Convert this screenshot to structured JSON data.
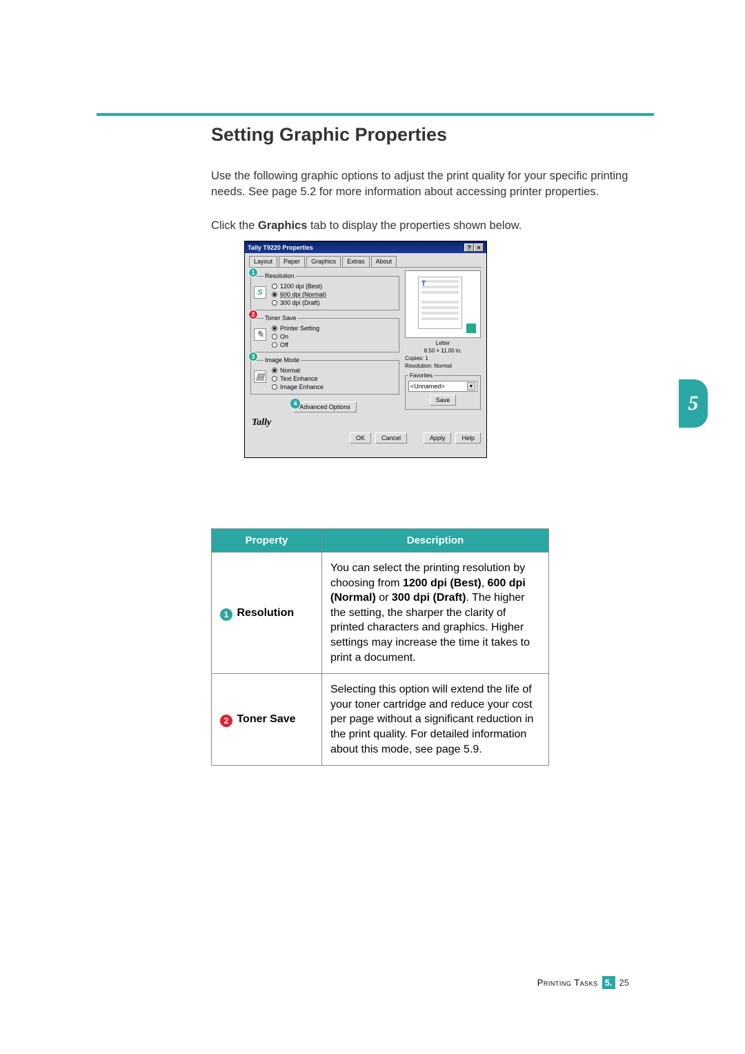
{
  "heading": "Setting Graphic Properties",
  "intro": "Use the following graphic options to adjust the print quality for your specific printing needs. See page 5.2 for more information about accessing printer properties.",
  "clickline_pre": "Click the ",
  "clickline_bold": "Graphics",
  "clickline_post": " tab to display the properties shown below.",
  "window": {
    "title": "Tally T9220 Properties",
    "help_btn": "?",
    "close_btn": "×",
    "tabs": [
      "Layout",
      "Paper",
      "Graphics",
      "Extras",
      "About"
    ],
    "active_tab": 2,
    "resolution": {
      "legend": "Resolution",
      "icon_letter": "S",
      "options": [
        "1200 dpi (Best)",
        "600 dpi (Normal)",
        "300 dpi (Draft)"
      ],
      "selected": 1,
      "callout": "1"
    },
    "toner_save": {
      "legend": "Toner Save",
      "options": [
        "Printer Setting",
        "On",
        "Off"
      ],
      "selected": 0,
      "callout": "2"
    },
    "image_mode": {
      "legend": "Image Mode",
      "options": [
        "Normal",
        "Text Enhance",
        "Image Enhance"
      ],
      "selected": 0,
      "callout": "3"
    },
    "advanced_btn": "Advanced Options",
    "advanced_callout": "4",
    "preview": {
      "size_name": "Letter",
      "size_dim": "8.50 × 11.00 in.",
      "copies": "Copies: 1",
      "resolution": "Resolution: Normal"
    },
    "favorites": {
      "legend": "Favorites",
      "value": "<Unnamed>",
      "save_btn": "Save"
    },
    "brand": "Tally",
    "buttons": {
      "ok": "OK",
      "cancel": "Cancel",
      "apply": "Apply",
      "help": "Help"
    }
  },
  "table": {
    "head_property": "Property",
    "head_description": "Description",
    "rows": [
      {
        "circ_num": "1",
        "circ_class": "c1",
        "name": "Resolution",
        "desc_pre": "You can select the printing resolution by choosing from ",
        "desc_b1": "1200 dpi (Best)",
        "desc_mid1": ", ",
        "desc_b2": "600 dpi (Normal)",
        "desc_mid2": " or ",
        "desc_b3": "300 dpi (Draft)",
        "desc_post": ". The higher the setting, the sharper the clarity of printed characters and graphics. Higher settings may increase the time it takes to print a document."
      },
      {
        "circ_num": "2",
        "circ_class": "c2",
        "name": "Toner Save",
        "desc_plain": "Selecting this option will extend the life of your toner cartridge and reduce your cost per page without a significant reduction in the print quality. For detailed information about this mode, see page 5.9."
      }
    ]
  },
  "footer": {
    "section": "Printing Tasks",
    "chapter": "5.",
    "page": "25"
  },
  "chapter_tab": "5"
}
